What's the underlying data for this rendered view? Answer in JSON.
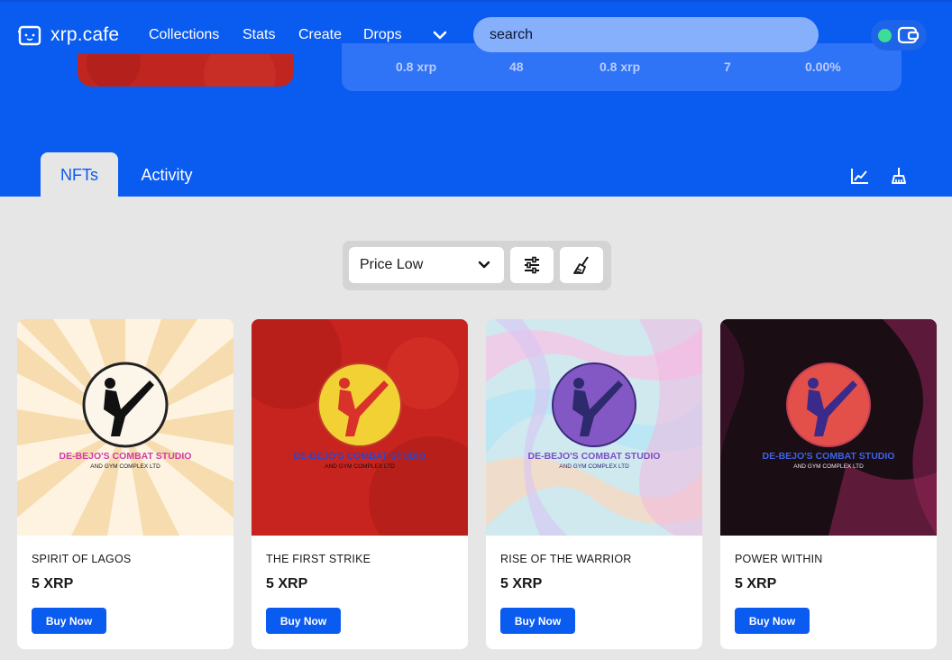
{
  "brand": {
    "name": "xrp.cafe"
  },
  "nav": {
    "links": [
      "Collections",
      "Stats",
      "Create",
      "Drops"
    ],
    "more_icon": "chevron-down-icon"
  },
  "search": {
    "placeholder": "search"
  },
  "wallet": {
    "status_color": "#3ddc97",
    "icon": "wallet-icon"
  },
  "collection_stats": [
    "0.8 xrp",
    "48",
    "0.8 xrp",
    "7",
    "0.00%"
  ],
  "tabs": [
    {
      "label": "NFTs",
      "active": true
    },
    {
      "label": "Activity",
      "active": false
    }
  ],
  "header_actions": [
    {
      "icon": "chart-line-icon"
    },
    {
      "icon": "sweep-icon"
    }
  ],
  "filters": {
    "sort_selected": "Price Low",
    "sort_icon": "chevron-down-icon",
    "filter_icon": "sliders-icon",
    "sweep_icon": "broom-icon"
  },
  "cards": [
    {
      "name": "SPIRIT OF LAGOS",
      "price": "5 XRP",
      "button": "Buy Now",
      "logo_line1": "DE-BEJO'S COMBAT STUDIO",
      "logo_line2": "AND GYM COMPLEX LTD"
    },
    {
      "name": "THE FIRST STRIKE",
      "price": "5 XRP",
      "button": "Buy Now",
      "logo_line1": "DE-BEJO'S COMBAT STUDIO",
      "logo_line2": "AND GYM COMPLEX LTD"
    },
    {
      "name": "RISE OF THE WARRIOR",
      "price": "5 XRP",
      "button": "Buy Now",
      "logo_line1": "DE-BEJO'S COMBAT STUDIO",
      "logo_line2": "AND GYM COMPLEX LTD"
    },
    {
      "name": "POWER WITHIN",
      "price": "5 XRP",
      "button": "Buy Now",
      "logo_line1": "DE-BEJO'S COMBAT STUDIO",
      "logo_line2": "AND GYM COMPLEX LTD"
    }
  ],
  "colors": {
    "brand_blue": "#0a5bf0",
    "search_bg": "#86b0fb",
    "page_bg": "#e6e6e6"
  }
}
